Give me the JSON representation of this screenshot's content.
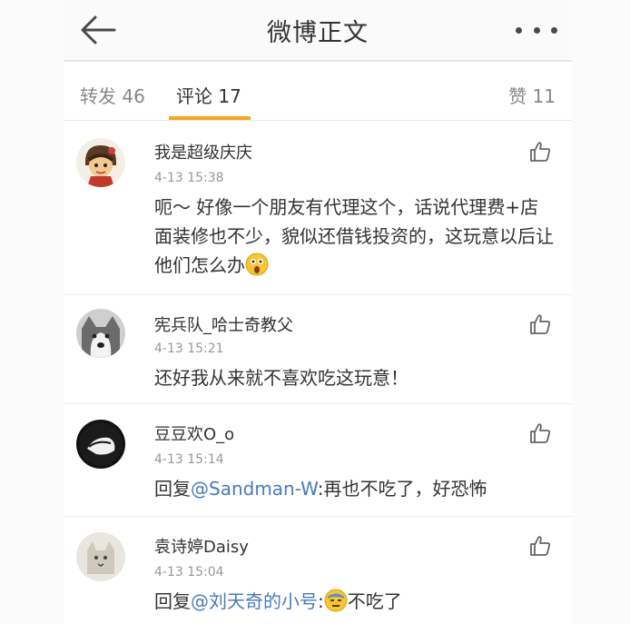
{
  "header": {
    "title": "微博正文"
  },
  "tabs": {
    "repost": "转发 46",
    "comments": "评论 17",
    "likes": "赞 11"
  },
  "comments": [
    {
      "username": "我是超级庆庆",
      "time": "4-13 15:38",
      "text_1": "呃～ 好像一个朋友有代理这个，话说代理费+店面装修也不少，貌似还借钱投资的，这玩意以后让他们怎么办",
      "emoji": "surprised-emoji"
    },
    {
      "username": "宪兵队_哈士奇教父",
      "time": "4-13 15:21",
      "text_1": "还好我从来就不喜欢吃这玩意！"
    },
    {
      "username": "豆豆欢O_o",
      "time": "4-13 15:14",
      "reply_prefix": "回复",
      "mention": "@Sandman-W",
      "text_2": ":再也不吃了，好恐怖"
    },
    {
      "username": "袁诗婷Daisy",
      "time": "4-13 15:04",
      "reply_prefix": "回复",
      "mention": "@刘天奇的小号",
      "text_sep": ":",
      "text_2": "不吃了",
      "emoji": "sweat-emoji"
    }
  ],
  "colors": {
    "accent": "#f5a623",
    "mention": "#4a7ab8"
  }
}
